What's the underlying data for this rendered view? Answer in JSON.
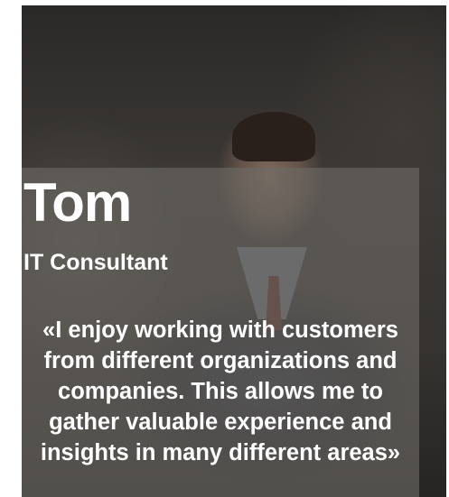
{
  "profile": {
    "name": "Tom",
    "role": "IT Consultant",
    "quote": "«I enjoy working with customers from different organizations and companies. This allows me to gather valuable experience and insights in many different areas»"
  },
  "colors": {
    "text": "#ffffff",
    "overlay": "#6e6a66"
  }
}
